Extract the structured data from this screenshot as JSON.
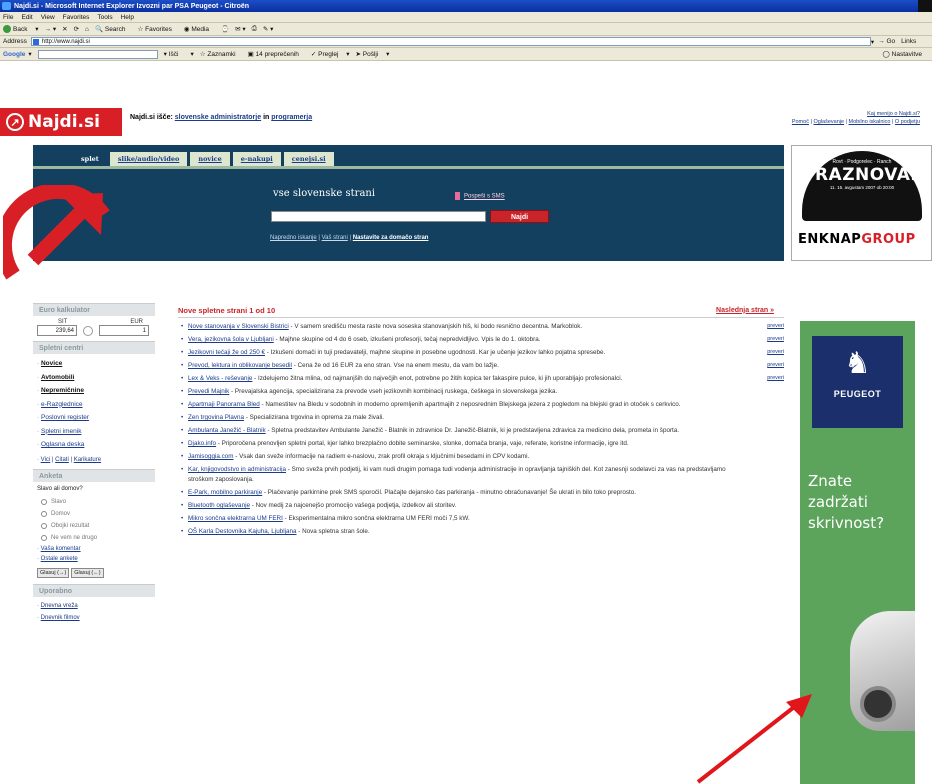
{
  "window": {
    "title": "Najdi.si - Microsoft Internet Explorer Izvozni par PSA Peugeot - Citroën"
  },
  "menu": [
    "File",
    "Edit",
    "View",
    "Favorites",
    "Tools",
    "Help"
  ],
  "toolbar": {
    "back": "Back",
    "search": "Search",
    "favorites": "Favorites",
    "media": "Media"
  },
  "address": {
    "label": "Address",
    "url": "http://www.najdi.si",
    "go": "Go",
    "links": "Links"
  },
  "google_bar": {
    "logo": "Google",
    "search_web": "Išči",
    "bookmarks": "Zaznamki",
    "blocked": "14 preprečenih",
    "options": "Preglej",
    "send": "Pošlji",
    "settings": "Nastavitve"
  },
  "header": {
    "logo": "Najdi.si",
    "tagline_prefix": "Najdi.si išče:",
    "tagline_link1": "slovenske administratorje",
    "tagline_mid": "in",
    "tagline_link2": "programerja",
    "link_top": "Kaj menijo o Najdi.si?",
    "links_bottom": [
      "Pomoč",
      "Oglaševanje",
      "Mobilno iskalnico",
      "O podjetju"
    ]
  },
  "search": {
    "tabs": [
      "splet",
      "slike/audio/video",
      "novice",
      "e-nakupi",
      "cenejsi.si"
    ],
    "active_tab": "splet",
    "title": "vse slovenske strani",
    "sms_link": "Pospeši s SMS",
    "input_value": "",
    "button": "Najdi",
    "options": [
      "Napredno iskanje",
      "Vaš strani",
      "Nastavite za domačo stran"
    ]
  },
  "promo": {
    "small_top": "Rovt · Podgorelec · Ranch",
    "big": "PRAZNOVANJE",
    "sub": "11. 15. avgustam 2007 ob 20:00",
    "bottom_black": "ENKNAP",
    "bottom_red": "GROUP"
  },
  "converter": {
    "title": "Euro kalkulator",
    "label_sit": "SIT",
    "label_eur": "EUR",
    "sit_value": "239,64",
    "eur_value": "1"
  },
  "sites": {
    "title": "Spletni centri",
    "items": [
      {
        "label": "Novice",
        "strong": true
      },
      {
        "label": "Avtomobili",
        "strong": true
      },
      {
        "label": "Nepremičnine",
        "strong": true
      },
      {
        "label": "e-Razglednice",
        "strong": false
      },
      {
        "label": "Poslovni register",
        "strong": false
      },
      {
        "label": "Spletni imenik",
        "strong": false
      },
      {
        "label": "Oglasna deska",
        "strong": false
      }
    ],
    "inline": [
      "Vici",
      "Citati",
      "Karikature"
    ]
  },
  "poll": {
    "title": "Anketa",
    "question": "Slavo ali domov?",
    "options": [
      "Slavo",
      "Domov",
      "Obojki rezultat",
      "Ne vem ne drugo"
    ],
    "links": [
      "Vaša komentar",
      "Ostale ankete"
    ],
    "buttons": [
      "Glasuj (→)",
      "Glasuj (←)"
    ]
  },
  "tools": {
    "title": "Uporabno",
    "items": [
      "Dnevna vreža",
      "Dnevnik filmov"
    ]
  },
  "news": {
    "title": "Nove spletne strani 1 od 10",
    "next": "Naslednja stran »",
    "items": [
      {
        "title": "Nove stanovanja v Slovenski Bistrici",
        "text": " - V samem središču mesta raste nova soseska stanovanjskih hiš, ki bodo resnično decentna. Markoblok.",
        "rep": "preveri"
      },
      {
        "title": "Vera, jezikovna šola v Ljubljani",
        "text": " - Majhne skupine od 4 do 6 oseb, izkušeni profesorji, tečaj nepredvidljivo. Vpis le do 1. oktobra.",
        "rep": "preveri"
      },
      {
        "title": "Jezikovni tečaji že od 250 €",
        "text": " - Izkušeni domači in tuji predavatelji, majhne skupine in posebne ugodnosti. Kar je učenje jezikov lahko pojatna spresebe.",
        "rep": "preveri"
      },
      {
        "title": "Prevod, lektura in oblikovanje besedil",
        "text": " - Cena že od 16 EUR za eno stran. Vse na enem mestu, da vam bo lažje.",
        "rep": "preveri"
      },
      {
        "title": "Lex & Veks - reševanje",
        "text": " - Izdelujemo žitna mlina, od najmanjših do največjih enot, potrebne po žitih kopica ter fakaspire pulce, ki jih uporabljajo profesionalci.",
        "rep": "preveri"
      },
      {
        "title": "Prevedi Majnik",
        "text": " - Prevajalska agencija, specializirana za prevode vseh jezikovnih kombinacij ruskega, češkega in slovenskega jezika.",
        "rep": ""
      },
      {
        "title": "Apartmaji Panorama Bled",
        "text": " - Namestitev na Bledu v sodobnih in moderno opremljenih apartmajih z neposrednim Blejskega jezera z pogledom na blejski grad in otoček s cerkvico.",
        "rep": ""
      },
      {
        "title": "Zen trgovina Plavna",
        "text": " - Specializirana trgovina in oprema za male živali.",
        "rep": ""
      },
      {
        "title": "Ambulanta Janežič - Blatnik",
        "text": " - Spletna predstavitev Ambulante Janežič - Blatnik in zdravnice Dr. Janežič-Blatnik, ki je predstavljena zdravica za medicino dela, prometa in športa.",
        "rep": ""
      },
      {
        "title": "Djako.info",
        "text": " - Priporočena prenovljen spletni portal, kjer lahko brezplačno dobite seminarske, slonke, domača branja, vaje, referate, koristne informacije, igre itd.",
        "rep": ""
      },
      {
        "title": "Jamisoggia.com",
        "text": " - Vsak dan sveže informacije na radiem e-naslovu, zrak profil okraja s ključnimi besedami in CPV kodami.",
        "rep": ""
      },
      {
        "title": "Kar, knjigovodstvo in administracija",
        "text": " - Smo sveža prvih podjetij, ki vam nudi drugim pomaga tudi vodenja administracije in opravljanja tajniških del. Kot zanesnji sodelavci za vas na predstavljamo stroškom zaposlovanja.",
        "rep": ""
      },
      {
        "title": "E-Park, mobilno parkiranje",
        "text": " - Plačevanje parkirnine prek SMS sporočil. Plačajte dejansko čas parkiranja - minutno obračunavanje! Še ukrati in bilo toko preprosto.",
        "rep": ""
      },
      {
        "title": "Bluetooth oglaševanje",
        "text": " - Nov medij za najcenejšo promocijo vašega podjetja, izdelkov ali storitev.",
        "rep": ""
      },
      {
        "title": "Mikro sončna elektrarna UM FERI",
        "text": " - Eksperimentalna mikro sončna elektrarna UM FERI moči 7,5 kW.",
        "rep": ""
      },
      {
        "title": "OŠ Karla Destovnika Kajuha, Ljubljana",
        "text": " - Nova spletna stran šole.",
        "rep": ""
      }
    ]
  },
  "ad": {
    "brand": "PEUGEOT",
    "slogan_lines": [
      "Znate",
      "zadržati",
      "skrivnost?"
    ]
  },
  "colors": {
    "brand_red": "#d81f26",
    "panel_blue": "#12405e",
    "ad_green": "#5ca35c",
    "arrow_red": "#e0161b"
  }
}
